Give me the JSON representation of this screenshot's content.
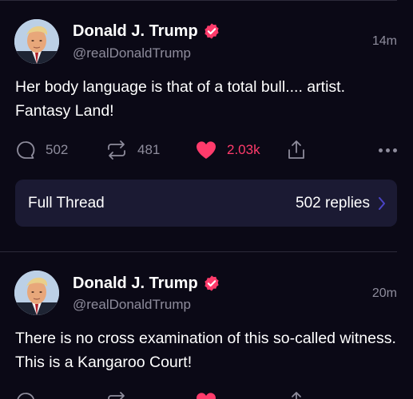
{
  "posts": [
    {
      "author_name": "Donald J. Trump",
      "handle": "@realDonaldTrump",
      "timestamp": "14m",
      "text": "Her body language is that of a total bull.... artist. Fantasy Land!",
      "replies": "502",
      "reposts": "481",
      "likes": "2.03k",
      "verified": true
    },
    {
      "author_name": "Donald J. Trump",
      "handle": "@realDonaldTrump",
      "timestamp": "20m",
      "text": "There is no cross examination of this so-called witness. This is a Kangaroo Court!",
      "verified": true
    }
  ],
  "thread": {
    "title": "Full Thread",
    "replies_label": "502 replies"
  },
  "colors": {
    "background": "#0b0916",
    "accent_like": "#ff3b6b",
    "verified_badge": "#ff3b6b",
    "muted_text": "#8e8c9c",
    "thread_card": "#1b1a33"
  },
  "icons": [
    "verified-badge-icon",
    "reply-icon",
    "repost-icon",
    "heart-icon",
    "share-icon",
    "more-icon",
    "chevron-right-icon"
  ]
}
